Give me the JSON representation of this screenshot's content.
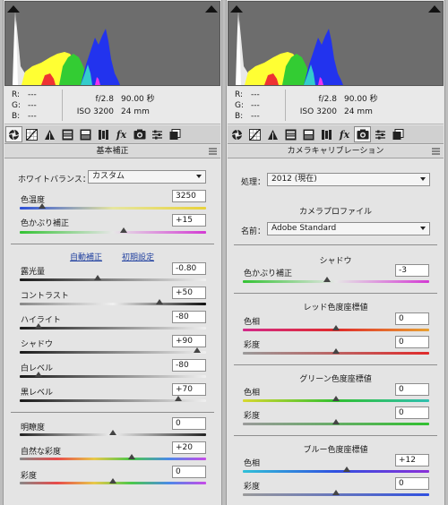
{
  "left": {
    "rgb": [
      {
        "k": "R:",
        "v": "---"
      },
      {
        "k": "G:",
        "v": "---"
      },
      {
        "k": "B:",
        "v": "---"
      }
    ],
    "camera": {
      "aperture": "f/2.8",
      "shutter": "90.00 秒",
      "iso": "ISO 3200",
      "focal": "24 mm"
    },
    "panel_title": "基本補正",
    "white_balance": {
      "label": "ホワイトバランス：",
      "value": "カスタム"
    },
    "temperature": {
      "label": "色温度",
      "value": "3250",
      "position": 0.12
    },
    "tint": {
      "label": "色かぶり補正",
      "value": "+15",
      "position": 0.56
    },
    "auto_link": "自動補正",
    "default_link": "初期設定",
    "exposure": {
      "label": "露光量",
      "value": "-0.80",
      "position": 0.42
    },
    "contrast": {
      "label": "コントラスト",
      "value": "+50",
      "position": 0.75
    },
    "highlights": {
      "label": "ハイライト",
      "value": "-80",
      "position": 0.1
    },
    "shadows": {
      "label": "シャドウ",
      "value": "+90",
      "position": 0.95
    },
    "whites": {
      "label": "白レベル",
      "value": "-80",
      "position": 0.1
    },
    "blacks": {
      "label": "黒レベル",
      "value": "+70",
      "position": 0.85
    },
    "clarity": {
      "label": "明瞭度",
      "value": "0",
      "position": 0.5
    },
    "vibrance": {
      "label": "自然な彩度",
      "value": "+20",
      "position": 0.6
    },
    "saturation": {
      "label": "彩度",
      "value": "0",
      "position": 0.5
    }
  },
  "right": {
    "rgb": [
      {
        "k": "R:",
        "v": "---"
      },
      {
        "k": "G:",
        "v": "---"
      },
      {
        "k": "B:",
        "v": "---"
      }
    ],
    "camera": {
      "aperture": "f/2.8",
      "shutter": "90.00 秒",
      "iso": "ISO 3200",
      "focal": "24 mm"
    },
    "panel_title": "カメラキャリブレーション",
    "process": {
      "label": "処理：",
      "value": "2012 (現在)"
    },
    "profile_title": "カメラプロファイル",
    "name": {
      "label": "名前：",
      "value": "Adobe Standard"
    },
    "shadow_title": "シャドウ",
    "shadow_tint": {
      "label": "色かぶり補正",
      "value": "-3",
      "position": 0.45
    },
    "red_title": "レッド色度座標値",
    "red_hue": {
      "label": "色相",
      "value": "0",
      "position": 0.5
    },
    "red_sat": {
      "label": "彩度",
      "value": "0",
      "position": 0.5
    },
    "green_title": "グリーン色度座標値",
    "green_hue": {
      "label": "色相",
      "value": "0",
      "position": 0.5
    },
    "green_sat": {
      "label": "彩度",
      "value": "0",
      "position": 0.5
    },
    "blue_title": "ブルー色度座標値",
    "blue_hue": {
      "label": "色相",
      "value": "+12",
      "position": 0.56
    },
    "blue_sat": {
      "label": "彩度",
      "value": "0",
      "position": 0.5
    }
  },
  "tab_icons": [
    "aperture-icon",
    "tone-curve-icon",
    "detail-icon",
    "hsl-icon",
    "split-toning-icon",
    "lens-corrections-icon",
    "effects-icon",
    "camera-calibration-icon",
    "presets-icon",
    "snapshots-icon"
  ]
}
